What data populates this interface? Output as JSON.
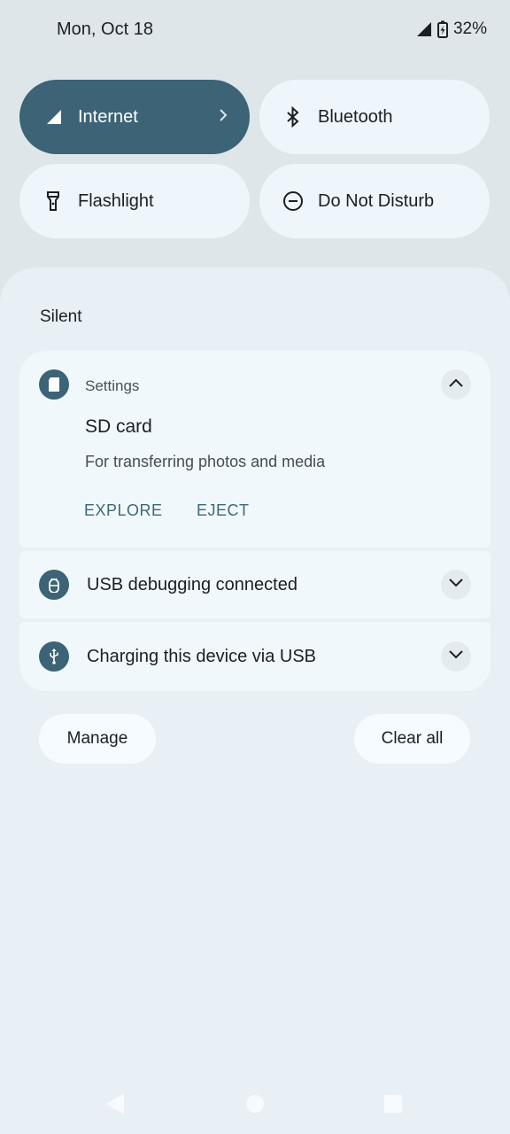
{
  "status_bar": {
    "date": "Mon, Oct 18",
    "battery_text": "32%",
    "icons": [
      "signal-icon",
      "battery-charging-icon"
    ]
  },
  "quick_tiles": [
    {
      "label": "Internet",
      "icon": "signal-icon",
      "active": true
    },
    {
      "label": "Bluetooth",
      "icon": "bluetooth-icon",
      "active": false
    },
    {
      "label": "Flashlight",
      "icon": "flashlight-icon",
      "active": false
    },
    {
      "label": "Do Not Disturb",
      "icon": "do-not-disturb-icon",
      "active": false
    }
  ],
  "notifications": {
    "section_title": "Silent",
    "items": [
      {
        "app": "Settings",
        "icon": "sd-card-icon",
        "title": "SD card",
        "text": "For transferring photos and media",
        "actions": [
          "EXPLORE",
          "EJECT"
        ],
        "expanded": true
      },
      {
        "title": "USB debugging connected",
        "icon": "android-debug-icon",
        "expanded": false
      },
      {
        "title": "Charging this device via USB",
        "icon": "usb-icon",
        "expanded": false
      }
    ]
  },
  "footer": {
    "manage_label": "Manage",
    "clear_all_label": "Clear all"
  },
  "nav_bar": {
    "icons": [
      "back-icon",
      "home-icon",
      "recents-icon"
    ]
  },
  "colors": {
    "accent": "#3c6376",
    "background": "#dfe6ea",
    "shade": "#e8f0f6",
    "card": "#f1f8fc",
    "action_text": "#3b6a74"
  }
}
